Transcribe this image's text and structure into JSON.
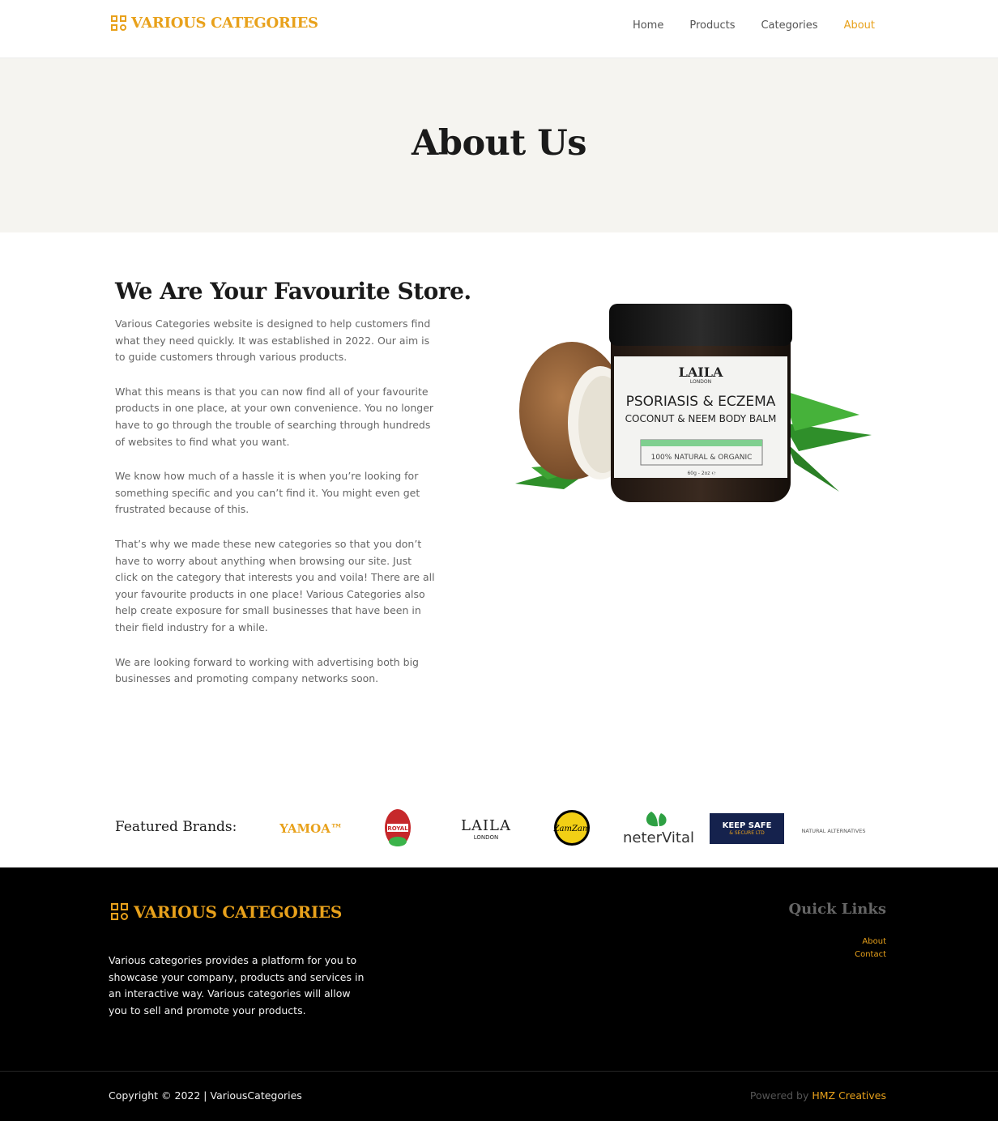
{
  "brand": {
    "name": "VARIOUS CATEGORIES",
    "accent_color": "#e8a11b",
    "logo_icon": "grid-icon"
  },
  "nav": {
    "items": [
      {
        "label": "Home",
        "active": false
      },
      {
        "label": "Products",
        "active": false
      },
      {
        "label": "Categories",
        "active": false
      },
      {
        "label": "About",
        "active": true
      }
    ]
  },
  "hero": {
    "title": "About Us"
  },
  "about": {
    "heading": "We Are Your Favourite Store.",
    "paragraphs": [
      "Various Categories website is designed to help customers find what they need quickly. It was established in 2022. Our aim is to guide customers through various products.",
      "What this means is that you can now find all of your favourite products in one place, at your own convenience. You no longer have to go through the trouble of searching through hundreds of websites to find what you want.",
      "We know how much of a hassle it is when you’re looking for something specific and you can’t find it. You might even get frustrated because of this.",
      "That’s why we made these new categories so that you don’t have to worry about anything when browsing our site. Just click on the category that interests you and voila! There are all your favourite products in one place! Various Categories also help create exposure for small businesses that have been in their field industry for a while.",
      "We are looking forward to working with advertising both big businesses and promoting company networks soon."
    ]
  },
  "product": {
    "brand": "LAILA",
    "brand_sub": "LONDON",
    "line1": "PSORIASIS & ECZEMA",
    "line2": "COCONUT & NEEM BODY BALM",
    "badge": "100% NATURAL & ORGANIC",
    "weight": "60g - 2oz ℮"
  },
  "brands": {
    "label": "Featured Brands:",
    "logos": [
      {
        "text": "YAMOA™"
      },
      {
        "text": "ROYAL"
      },
      {
        "text": "LAILA",
        "sub": "LONDON"
      },
      {
        "text": "ZamZam"
      },
      {
        "text": "neterVital"
      },
      {
        "text": "KEEP SAFE",
        "sub": "& SECURE LTD"
      },
      {
        "text": "NATURAL ALTERNATIVES"
      }
    ]
  },
  "footer": {
    "brand": "VARIOUS CATEGORIES",
    "description": "Various categories provides a platform for you to showcase your company, products and services in an interactive way. Various categories will allow you to sell and promote your products.",
    "quick_links_title": "Quick Links",
    "quick_links": [
      "About",
      "Contact"
    ],
    "copyright": "Copyright © 2022 | VariousCategories",
    "powered_prefix": "Powered by",
    "powered_link": "HMZ Creatives"
  }
}
